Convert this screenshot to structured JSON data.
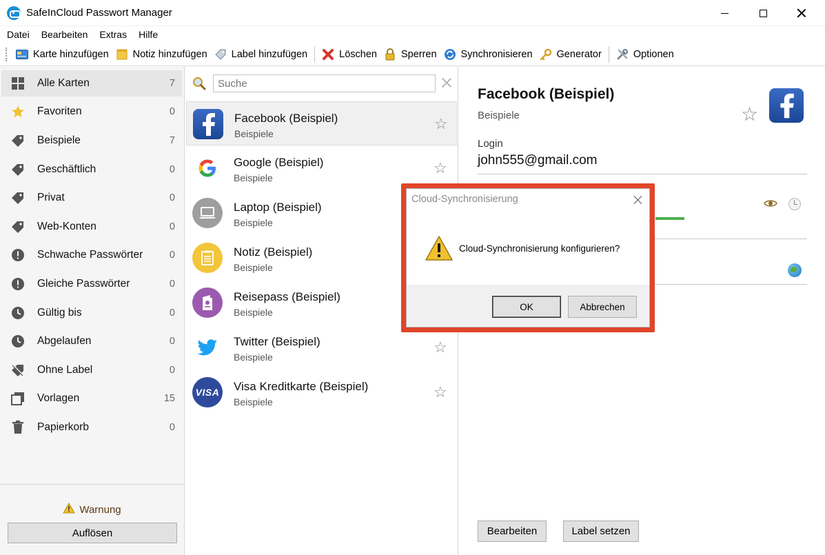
{
  "window": {
    "title": "SafeInCloud Passwort Manager"
  },
  "menu": [
    "Datei",
    "Bearbeiten",
    "Extras",
    "Hilfe"
  ],
  "toolbar": {
    "add_card": "Karte hinzufügen",
    "add_note": "Notiz hinzufügen",
    "add_label": "Label hinzufügen",
    "delete": "Löschen",
    "lock": "Sperren",
    "sync": "Synchronisieren",
    "generator": "Generator",
    "options": "Optionen"
  },
  "sidebar": {
    "items": [
      {
        "label": "Alle Karten",
        "count": "7",
        "icon": "grid-icon",
        "selected": true
      },
      {
        "label": "Favoriten",
        "count": "0",
        "icon": "star-icon"
      },
      {
        "label": "Beispiele",
        "count": "7",
        "icon": "tag-icon"
      },
      {
        "label": "Geschäftlich",
        "count": "0",
        "icon": "tag-icon"
      },
      {
        "label": "Privat",
        "count": "0",
        "icon": "tag-icon"
      },
      {
        "label": "Web-Konten",
        "count": "0",
        "icon": "tag-icon"
      },
      {
        "label": "Schwache Passwörter",
        "count": "0",
        "icon": "exclamation-icon"
      },
      {
        "label": "Gleiche Passwörter",
        "count": "0",
        "icon": "exclamation-icon"
      },
      {
        "label": "Gültig bis",
        "count": "0",
        "icon": "clock-icon"
      },
      {
        "label": "Abgelaufen",
        "count": "0",
        "icon": "clock-icon"
      },
      {
        "label": "Ohne Label",
        "count": "0",
        "icon": "no-tag-icon"
      },
      {
        "label": "Vorlagen",
        "count": "15",
        "icon": "templates-icon"
      },
      {
        "label": "Papierkorb",
        "count": "0",
        "icon": "trash-icon"
      }
    ],
    "warning": "Warnung",
    "resolve_button": "Auflösen"
  },
  "search": {
    "placeholder": "Suche"
  },
  "cards": [
    {
      "title": "Facebook (Beispiel)",
      "label": "Beispiele",
      "icon": "facebook-icon",
      "selected": true
    },
    {
      "title": "Google (Beispiel)",
      "label": "Beispiele",
      "icon": "google-icon"
    },
    {
      "title": "Laptop (Beispiel)",
      "label": "Beispiele",
      "icon": "laptop-icon"
    },
    {
      "title": "Notiz (Beispiel)",
      "label": "Beispiele",
      "icon": "note-icon"
    },
    {
      "title": "Reisepass (Beispiel)",
      "label": "Beispiele",
      "icon": "passport-icon"
    },
    {
      "title": "Twitter (Beispiel)",
      "label": "Beispiele",
      "icon": "twitter-icon"
    },
    {
      "title": "Visa Kreditkarte (Beispiel)",
      "label": "Beispiele",
      "icon": "visa-icon",
      "logo_text": "VISA"
    }
  ],
  "detail": {
    "title": "Facebook (Beispiel)",
    "label": "Beispiele",
    "login_label": "Login",
    "login_value": "john555@gmail.com",
    "edit_button": "Bearbeiten",
    "set_label_button": "Label setzen"
  },
  "dialog": {
    "title": "Cloud-Synchronisierung",
    "message": "Cloud-Synchronisierung konfigurieren?",
    "ok": "OK",
    "cancel": "Abbrechen"
  },
  "colors": {
    "accent": "#1a8fd6",
    "dialog_highlight": "#e0452a",
    "facebook": "#2d5fb3",
    "strength_bar": "#4caf50"
  }
}
